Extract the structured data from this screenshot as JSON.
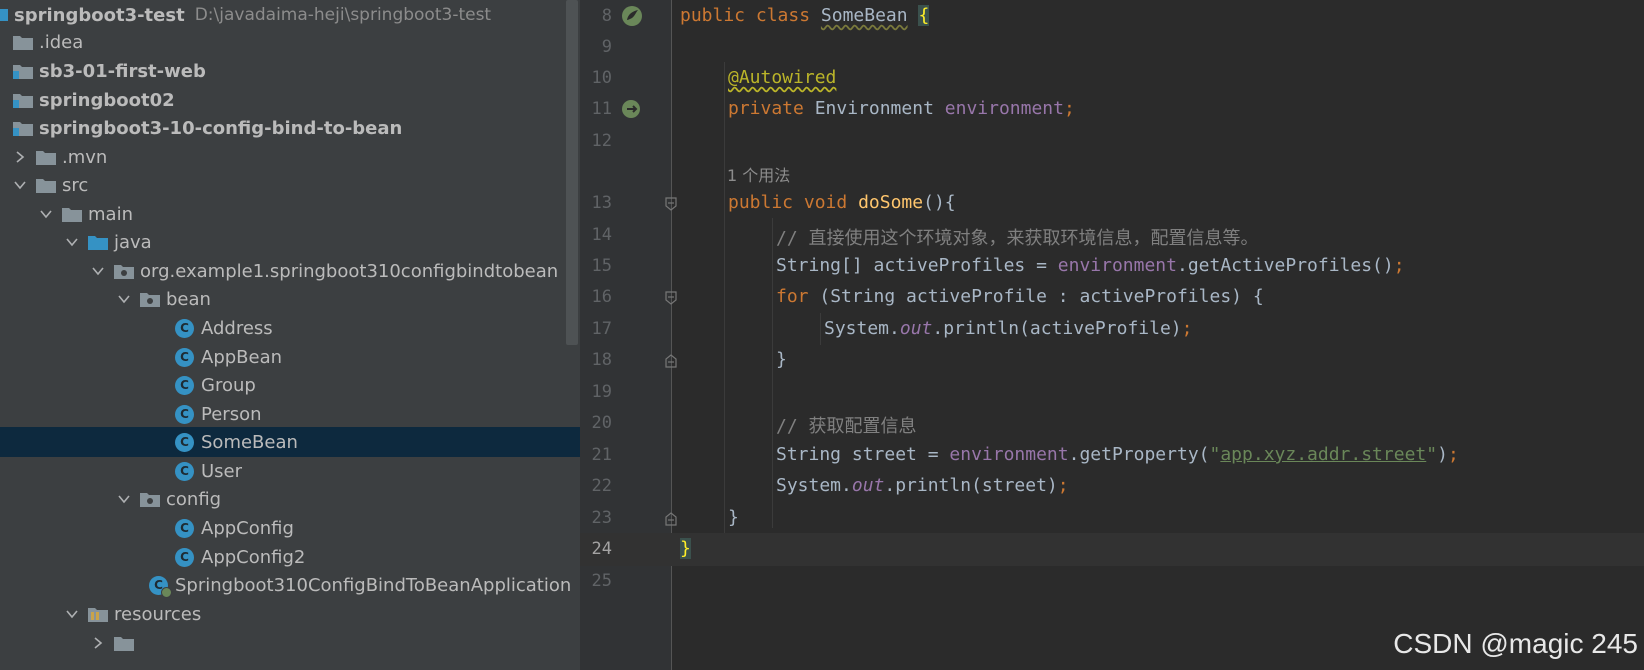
{
  "project_tree": {
    "root_name": "springboot3-test",
    "root_path": "D:\\javadaima-heji\\springboot3-test",
    "items": [
      {
        "label": "springboot3-test",
        "path": "D:\\javadaima-heji\\springboot3-test"
      },
      {
        "label": ".idea"
      },
      {
        "label": "sb3-01-first-web"
      },
      {
        "label": "springboot02"
      },
      {
        "label": "springboot3-10-config-bind-to-bean"
      },
      {
        "label": ".mvn"
      },
      {
        "label": "src"
      },
      {
        "label": "main"
      },
      {
        "label": "java"
      },
      {
        "label": "org.example1.springboot310configbindtobean"
      },
      {
        "label": "bean"
      },
      {
        "label": "Address",
        "icon": "C"
      },
      {
        "label": "AppBean",
        "icon": "C"
      },
      {
        "label": "Group",
        "icon": "C"
      },
      {
        "label": "Person",
        "icon": "C"
      },
      {
        "label": "SomeBean",
        "icon": "C"
      },
      {
        "label": "User",
        "icon": "C"
      },
      {
        "label": "config"
      },
      {
        "label": "AppConfig",
        "icon": "C"
      },
      {
        "label": "AppConfig2",
        "icon": "C"
      },
      {
        "label": "Springboot310ConfigBindToBeanApplication",
        "icon": "C"
      },
      {
        "label": "resources"
      }
    ],
    "selected_item": "SomeBean"
  },
  "editor": {
    "line_numbers": [
      "8",
      "9",
      "10",
      "11",
      "12",
      "13",
      "14",
      "15",
      "16",
      "17",
      "18",
      "19",
      "20",
      "21",
      "22",
      "23",
      "24",
      "25"
    ],
    "usage_hint": "1 个用法",
    "tokens": {
      "public": "public",
      "class": "class",
      "class_name": "SomeBean",
      "open_brace": "{",
      "close_brace": "}",
      "annotation": "@Autowired",
      "private": "private",
      "env_type": "Environment",
      "env_field": "environment",
      "semicolon": ";",
      "void": "void",
      "method_name": "doSome",
      "method_parens": "(){",
      "comment1": "// 直接使用这个环境对象，来获取环境信息，配置信息等。",
      "line15_a": "String[] activeProfiles = ",
      "line15_b": ".getActiveProfiles()",
      "for_kw": "for",
      "line16_rest": " (String activeProfile : activeProfiles) {",
      "system": "System.",
      "out": "out",
      "line17_rest": ".println(activeProfile)",
      "comment2": "// 获取配置信息",
      "line21_a": "String street = ",
      "line21_b": ".getProperty(",
      "quote": "\"",
      "string_value": "app.xyz.addr.street",
      "close_paren": ")",
      "line22_rest": ".println(street)"
    }
  },
  "watermark": "CSDN @magic 245",
  "icons": {
    "bean_gutter": "spring-bean-icon",
    "autowired_gutter": "autowired-navigation-icon",
    "folder": "folder-icon",
    "package": "package-icon",
    "class": "class-icon",
    "fold": "fold-marker-icon"
  },
  "colors": {
    "keyword": "#cc7832",
    "annotation": "#bbb529",
    "field": "#9876aa",
    "method": "#ffc66d",
    "comment": "#808080",
    "string": "#6a8759",
    "class_icon": "#3592c4",
    "selected_row": "#0d293e"
  }
}
